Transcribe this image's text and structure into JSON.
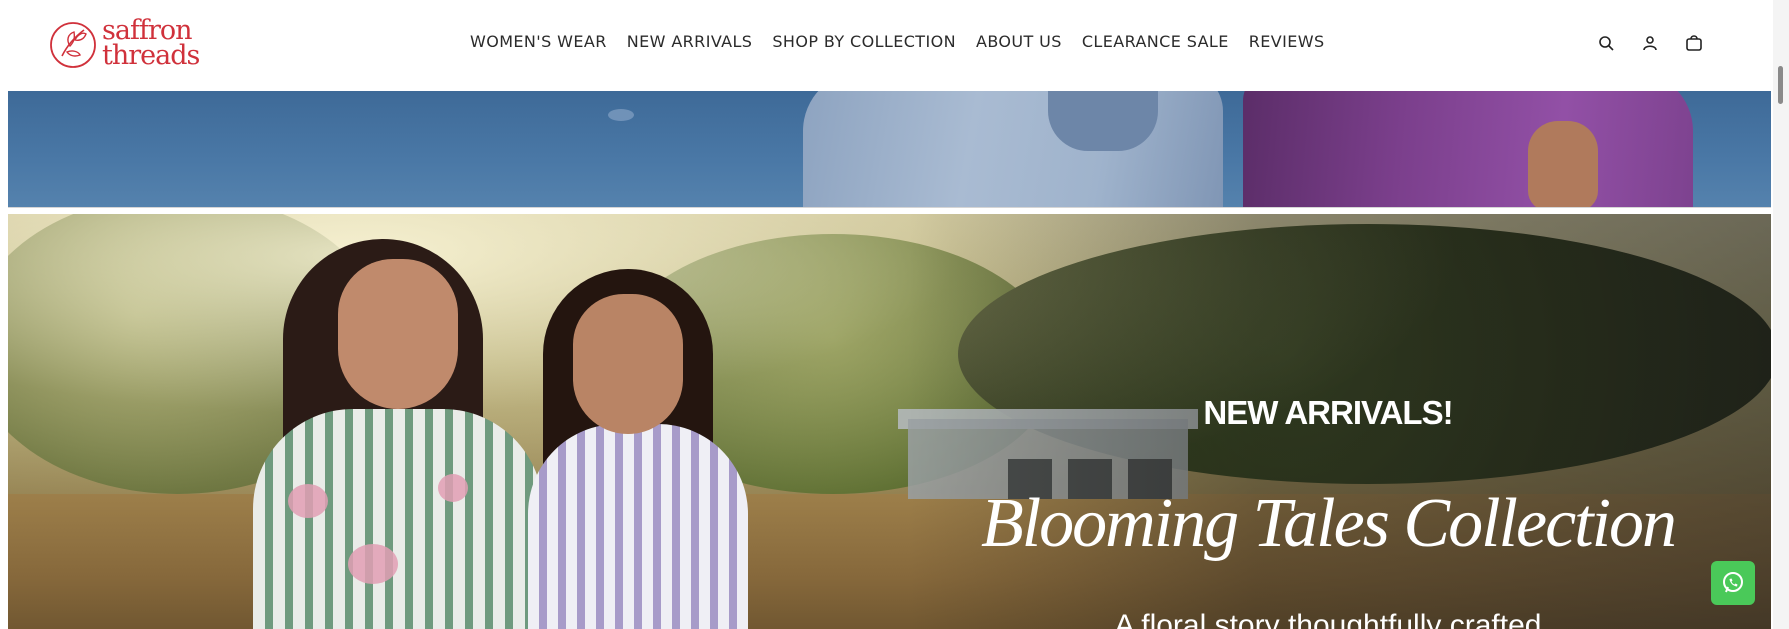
{
  "brand": {
    "line1": "saffron",
    "line2": "threads",
    "color": "#d0313b"
  },
  "nav": {
    "items": [
      {
        "label": "WOMEN'S WEAR"
      },
      {
        "label": "NEW ARRIVALS"
      },
      {
        "label": "SHOP BY COLLECTION"
      },
      {
        "label": "ABOUT US"
      },
      {
        "label": "CLEARANCE SALE"
      },
      {
        "label": "REVIEWS"
      }
    ]
  },
  "header_icons": [
    "search-icon",
    "account-icon",
    "cart-icon"
  ],
  "hero": {
    "kicker": "NEW ARRIVALS!",
    "title": "Blooming Tales Collection",
    "subtitle": "A floral story thoughtfully crafted"
  },
  "floating": {
    "whatsapp_icon": "whatsapp-icon",
    "whatsapp_color": "#4ac959"
  }
}
